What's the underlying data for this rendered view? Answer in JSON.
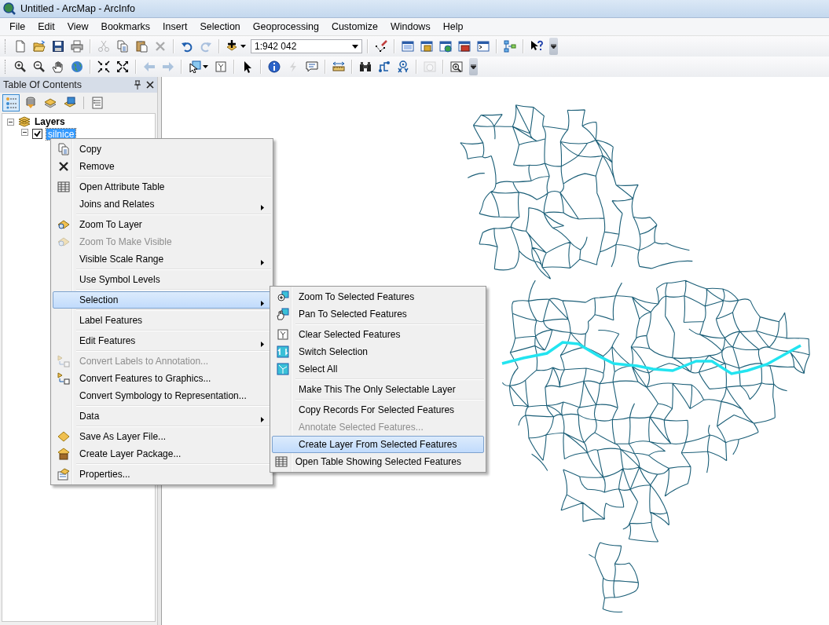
{
  "window": {
    "title": "Untitled - ArcMap - ArcInfo"
  },
  "menu_bar": [
    "File",
    "Edit",
    "View",
    "Bookmarks",
    "Insert",
    "Selection",
    "Geoprocessing",
    "Customize",
    "Windows",
    "Help"
  ],
  "toolbars": [
    [
      {
        "kind": "new-document",
        "disabled": false
      },
      {
        "kind": "open-folder",
        "disabled": false
      },
      {
        "kind": "floppy-disk",
        "disabled": false
      },
      {
        "kind": "printer",
        "disabled": false
      },
      {
        "kind": "separator"
      },
      {
        "kind": "scissors",
        "disabled": true
      },
      {
        "kind": "copy",
        "disabled": false
      },
      {
        "kind": "paste",
        "disabled": false
      },
      {
        "kind": "cross",
        "disabled": true
      },
      {
        "kind": "separator"
      },
      {
        "kind": "undo",
        "disabled": false
      },
      {
        "kind": "redo",
        "disabled": true
      },
      {
        "kind": "separator"
      },
      {
        "kind": "add-data",
        "disabled": false
      },
      {
        "kind": "scale-field",
        "value": "1:942 042"
      },
      {
        "kind": "separator"
      },
      {
        "kind": "pencil",
        "disabled": false
      },
      {
        "kind": "separator"
      },
      {
        "kind": "list-window",
        "disabled": false
      },
      {
        "kind": "catalog",
        "disabled": false
      },
      {
        "kind": "search-window",
        "disabled": false
      },
      {
        "kind": "toolbox",
        "disabled": false
      },
      {
        "kind": "command-window",
        "disabled": false
      },
      {
        "kind": "separator"
      },
      {
        "kind": "diagram",
        "disabled": false
      },
      {
        "kind": "separator"
      },
      {
        "kind": "help-pointer",
        "disabled": false
      },
      {
        "kind": "overflow"
      }
    ],
    [
      {
        "kind": "zoom-in",
        "disabled": false
      },
      {
        "kind": "zoom-out",
        "disabled": false
      },
      {
        "kind": "hand",
        "disabled": false
      },
      {
        "kind": "globe",
        "disabled": false
      },
      {
        "kind": "separator"
      },
      {
        "kind": "arrows-in",
        "disabled": false
      },
      {
        "kind": "arrows-out",
        "disabled": false
      },
      {
        "kind": "separator"
      },
      {
        "kind": "back-arrow",
        "disabled": true
      },
      {
        "kind": "forward-arrow",
        "disabled": true
      },
      {
        "kind": "separator"
      },
      {
        "kind": "select-features",
        "disabled": false
      },
      {
        "kind": "clear-selection",
        "disabled": false
      },
      {
        "kind": "separator"
      },
      {
        "kind": "pointer",
        "disabled": false
      },
      {
        "kind": "separator"
      },
      {
        "kind": "info",
        "disabled": false
      },
      {
        "kind": "lightning",
        "disabled": true
      },
      {
        "kind": "popup",
        "disabled": false
      },
      {
        "kind": "separator"
      },
      {
        "kind": "ruler",
        "disabled": false
      },
      {
        "kind": "separator"
      },
      {
        "kind": "binoculars",
        "disabled": false
      },
      {
        "kind": "route",
        "disabled": false
      },
      {
        "kind": "target",
        "disabled": false
      },
      {
        "kind": "separator"
      },
      {
        "kind": "time-window",
        "disabled": true
      },
      {
        "kind": "separator"
      },
      {
        "kind": "magnifier-window",
        "disabled": false
      },
      {
        "kind": "overflow"
      }
    ]
  ],
  "table_of_contents": {
    "title": "Table Of Contents",
    "tools": [
      {
        "kind": "drawing-order",
        "selected": true
      },
      {
        "kind": "source",
        "selected": false
      },
      {
        "kind": "visibility",
        "selected": false
      },
      {
        "kind": "selection",
        "selected": false
      },
      {
        "kind": "options",
        "selected": false
      }
    ],
    "tree": [
      {
        "label": "Layers",
        "expanded": true,
        "children": [
          {
            "label": "silnice",
            "expanded": true,
            "checked": true,
            "selected": true
          }
        ]
      }
    ]
  },
  "context_menu": {
    "groups": [
      [
        {
          "label": "Copy",
          "kind": "copy",
          "disabled": false,
          "submenu": false,
          "selected": false
        },
        {
          "label": "Remove",
          "kind": "cross",
          "disabled": false,
          "submenu": false,
          "selected": false
        }
      ],
      [
        {
          "label": "Open Attribute Table",
          "kind": "table",
          "disabled": false,
          "submenu": false,
          "selected": false
        },
        {
          "label": "Joins and Relates",
          "kind": "plain",
          "disabled": false,
          "submenu": true,
          "selected": false
        }
      ],
      [
        {
          "label": "Zoom To Layer",
          "kind": "zoom-layer",
          "disabled": false,
          "submenu": false,
          "selected": false
        },
        {
          "label": "Zoom To Make Visible",
          "kind": "zoom-layer",
          "disabled": true,
          "submenu": false,
          "selected": false
        },
        {
          "label": "Visible Scale Range",
          "kind": "plain",
          "disabled": false,
          "submenu": true,
          "selected": false
        }
      ],
      [
        {
          "label": "Use Symbol Levels",
          "kind": "plain",
          "disabled": false,
          "submenu": false,
          "selected": false
        }
      ],
      [
        {
          "label": "Selection",
          "kind": "plain",
          "disabled": false,
          "submenu": true,
          "selected": true
        }
      ],
      [
        {
          "label": "Label Features",
          "kind": "plain",
          "disabled": false,
          "submenu": false,
          "selected": false
        }
      ],
      [
        {
          "label": "Edit Features",
          "kind": "plain",
          "disabled": false,
          "submenu": true,
          "selected": false
        }
      ],
      [
        {
          "label": "Convert Labels to Annotation...",
          "kind": "convert",
          "disabled": true,
          "submenu": false,
          "selected": false
        },
        {
          "label": "Convert Features to Graphics...",
          "kind": "convert",
          "disabled": false,
          "submenu": false,
          "selected": false
        },
        {
          "label": "Convert Symbology to Representation...",
          "kind": "plain",
          "disabled": false,
          "submenu": false,
          "selected": false
        }
      ],
      [
        {
          "label": "Data",
          "kind": "plain",
          "disabled": false,
          "submenu": true,
          "selected": false
        }
      ],
      [
        {
          "label": "Save As Layer File...",
          "kind": "diamond",
          "disabled": false,
          "submenu": false,
          "selected": false
        },
        {
          "label": "Create Layer Package...",
          "kind": "package",
          "disabled": false,
          "submenu": false,
          "selected": false
        }
      ],
      [
        {
          "label": "Properties...",
          "kind": "properties",
          "disabled": false,
          "submenu": false,
          "selected": false
        }
      ]
    ]
  },
  "submenu": {
    "groups": [
      [
        {
          "label": "Zoom To Selected Features",
          "kind": "zoom-selected",
          "disabled": false,
          "selected": false
        },
        {
          "label": "Pan To Selected Features",
          "kind": "pan-selected",
          "disabled": false,
          "selected": false
        }
      ],
      [
        {
          "label": "Clear Selected Features",
          "kind": "clear-selection",
          "disabled": false,
          "selected": false
        },
        {
          "label": "Switch Selection",
          "kind": "switch",
          "disabled": false,
          "selected": false
        },
        {
          "label": "Select All",
          "kind": "select-all",
          "disabled": false,
          "selected": false
        }
      ],
      [
        {
          "label": "Make This The Only Selectable Layer",
          "kind": "plain",
          "disabled": false,
          "selected": false
        }
      ],
      [
        {
          "label": "Copy Records For Selected Features",
          "kind": "plain",
          "disabled": false,
          "selected": false
        },
        {
          "label": "Annotate Selected Features...",
          "kind": "plain",
          "disabled": true,
          "selected": false
        },
        {
          "label": "Create Layer From Selected Features",
          "kind": "plain",
          "disabled": false,
          "selected": true
        },
        {
          "label": "Open Table Showing Selected Features",
          "kind": "table",
          "disabled": false,
          "selected": false
        }
      ]
    ]
  }
}
